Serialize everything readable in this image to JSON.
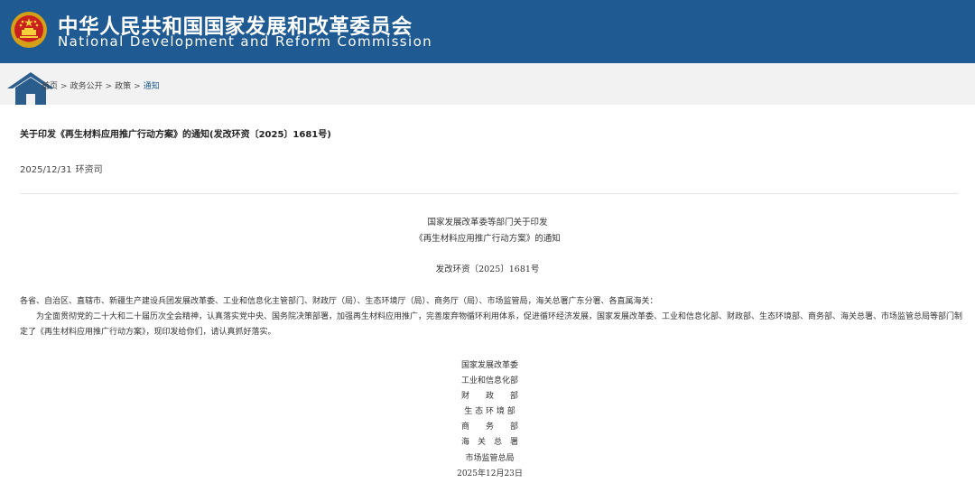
{
  "header": {
    "title_cn": "中华人民共和国国家发展和改革委员会",
    "title_en": "National Development and Reform Commission",
    "emblem_icon": "national-emblem-icon"
  },
  "breadcrumb": {
    "home_icon": "home-icon",
    "items": [
      "首页",
      "政务公开",
      "政策",
      "通知"
    ],
    "separator": ">"
  },
  "article": {
    "title": "关于印发《再生材料应用推广行动方案》的通知(发改环资〔2025〕1681号)",
    "date": "2025/12/31",
    "source": "环资司",
    "content_title_line1": "国家发展改革委等部门关于印发",
    "content_title_line2": "《再生材料应用推广行动方案》的通知",
    "doc_number": "发改环资〔2025〕1681号",
    "addressee": "各省、自治区、直辖市、新疆生产建设兵团发展改革委、工业和信息化主管部门、财政厅（局）、生态环境厅（局）、商务厅（局）、市场监管局，海关总署广东分署、各直属海关：",
    "body": "为全面贯彻党的二十大和二十届历次全会精神，认真落实党中央、国务院决策部署，加强再生材料应用推广，完善废弃物循环利用体系，促进循环经济发展，国家发展改革委、工业和信息化部、财政部、生态环境部、商务部、海关总署、市场监管总局等部门制定了《再生材料应用推广行动方案》，现印发给你们，请认真抓好落实。",
    "signatories": [
      "国家发展改革委",
      "工业和信息化部",
      "财　　政　　部",
      "生 态 环 境 部",
      "商　　务　　部",
      "海　关　总　署",
      "市场监管总局"
    ],
    "sign_date": "2025年12月23日"
  },
  "colors": {
    "header_bg": "#1f5a92",
    "breadcrumb_bg": "#f2f2f2",
    "link": "#1f5a92"
  }
}
